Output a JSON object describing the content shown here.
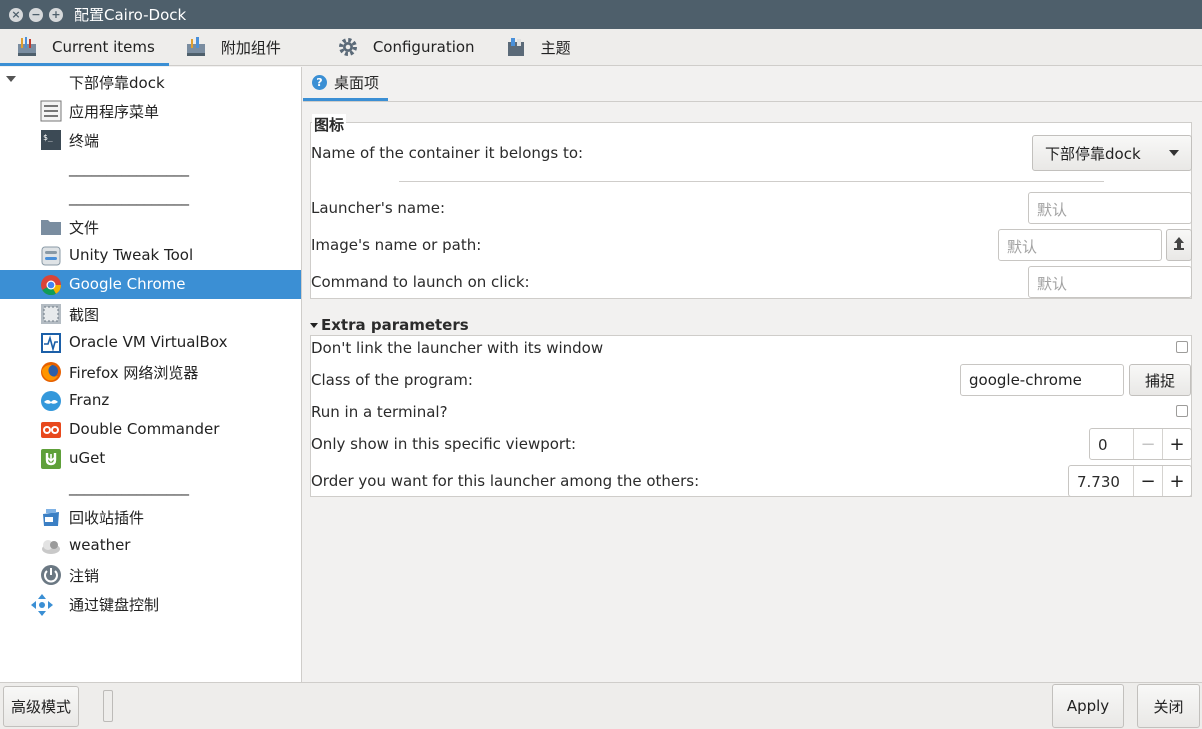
{
  "window": {
    "title": "配置Cairo-Dock"
  },
  "toolbar": {
    "tabs": [
      {
        "label": "Current items",
        "icon": "current-items-icon"
      },
      {
        "label": "附加组件",
        "icon": "addons-icon"
      },
      {
        "label": "Configuration",
        "icon": "gear-icon"
      },
      {
        "label": "主题",
        "icon": "themes-icon"
      }
    ]
  },
  "sidebar": {
    "root": "下部停靠dock",
    "items": [
      {
        "label": "应用程序菜单",
        "icon": "applications-menu-icon"
      },
      {
        "label": "终端",
        "icon": "terminal-icon"
      },
      {
        "label": "________________",
        "icon": ""
      },
      {
        "label": "________________",
        "icon": ""
      },
      {
        "label": "文件",
        "icon": "folder-icon"
      },
      {
        "label": "Unity Tweak Tool",
        "icon": "unity-tweak-icon"
      },
      {
        "label": "Google Chrome",
        "icon": "chrome-icon"
      },
      {
        "label": "截图",
        "icon": "screenshot-icon"
      },
      {
        "label": "Oracle VM VirtualBox",
        "icon": "virtualbox-icon"
      },
      {
        "label": "Firefox 网络浏览器",
        "icon": "firefox-icon"
      },
      {
        "label": "Franz",
        "icon": "franz-icon"
      },
      {
        "label": "Double Commander",
        "icon": "double-commander-icon"
      },
      {
        "label": "uGet",
        "icon": "uget-icon"
      },
      {
        "label": "________________",
        "icon": ""
      },
      {
        "label": "回收站插件",
        "icon": "trash-icon"
      },
      {
        "label": "weather",
        "icon": "weather-icon"
      },
      {
        "label": "注销",
        "icon": "power-icon"
      },
      {
        "label": "通过键盘控制",
        "icon": "keyboard-control-icon"
      }
    ]
  },
  "main": {
    "tab_label": "桌面项",
    "icon_section": {
      "title": "图标",
      "container_label": "Name of the container it belongs to:",
      "container_value": "下部停靠dock",
      "launcher_name_label": "Launcher's name:",
      "launcher_name_placeholder": "默认",
      "image_label": "Image's name or path:",
      "image_placeholder": "默认",
      "command_label": "Command to launch on click:",
      "command_placeholder": "默认"
    },
    "extra_section": {
      "title": "Extra parameters",
      "dont_link_label": "Don't link the launcher with its window",
      "class_label": "Class of the program:",
      "class_value": "google-chrome",
      "grab_button": "捕捉",
      "terminal_label": "Run in a terminal?",
      "viewport_label": "Only show in this specific viewport:",
      "viewport_value": "0",
      "order_label": "Order you want for this launcher among the others:",
      "order_value": "7.730",
      "minus": "−",
      "plus": "+"
    }
  },
  "bottom": {
    "advanced_mode": "高级模式",
    "apply": "Apply",
    "close": "关闭"
  }
}
